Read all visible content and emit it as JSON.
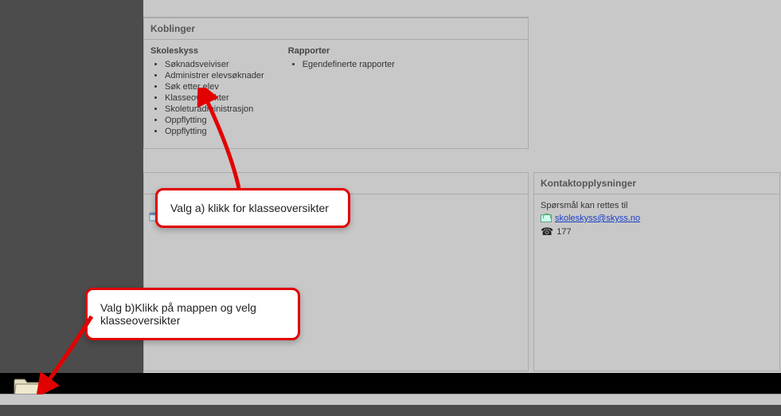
{
  "koblinger": {
    "title": "Koblinger",
    "col1": {
      "heading": "Skoleskyss",
      "items": [
        "Søknadsveiviser",
        "Administrer elevsøknader",
        "Søk etter elev",
        "Klasseoversikter",
        "Skoleturadministrasjon",
        "Oppflytting",
        "Oppflytting"
      ]
    },
    "col2": {
      "heading": "Rapporter",
      "items": [
        "Egendefinerte rapporter"
      ]
    }
  },
  "kontakt": {
    "title": "Kontaktopplysninger",
    "intro": "Spørsmål kan rettes til",
    "email": "skoleskyss@skyss.no",
    "phone": "177"
  },
  "callouts": {
    "a": "Valg a) klikk for klasseoversikter",
    "b": "Valg b)Klikk på  mappen og velg klasseoversikter"
  }
}
